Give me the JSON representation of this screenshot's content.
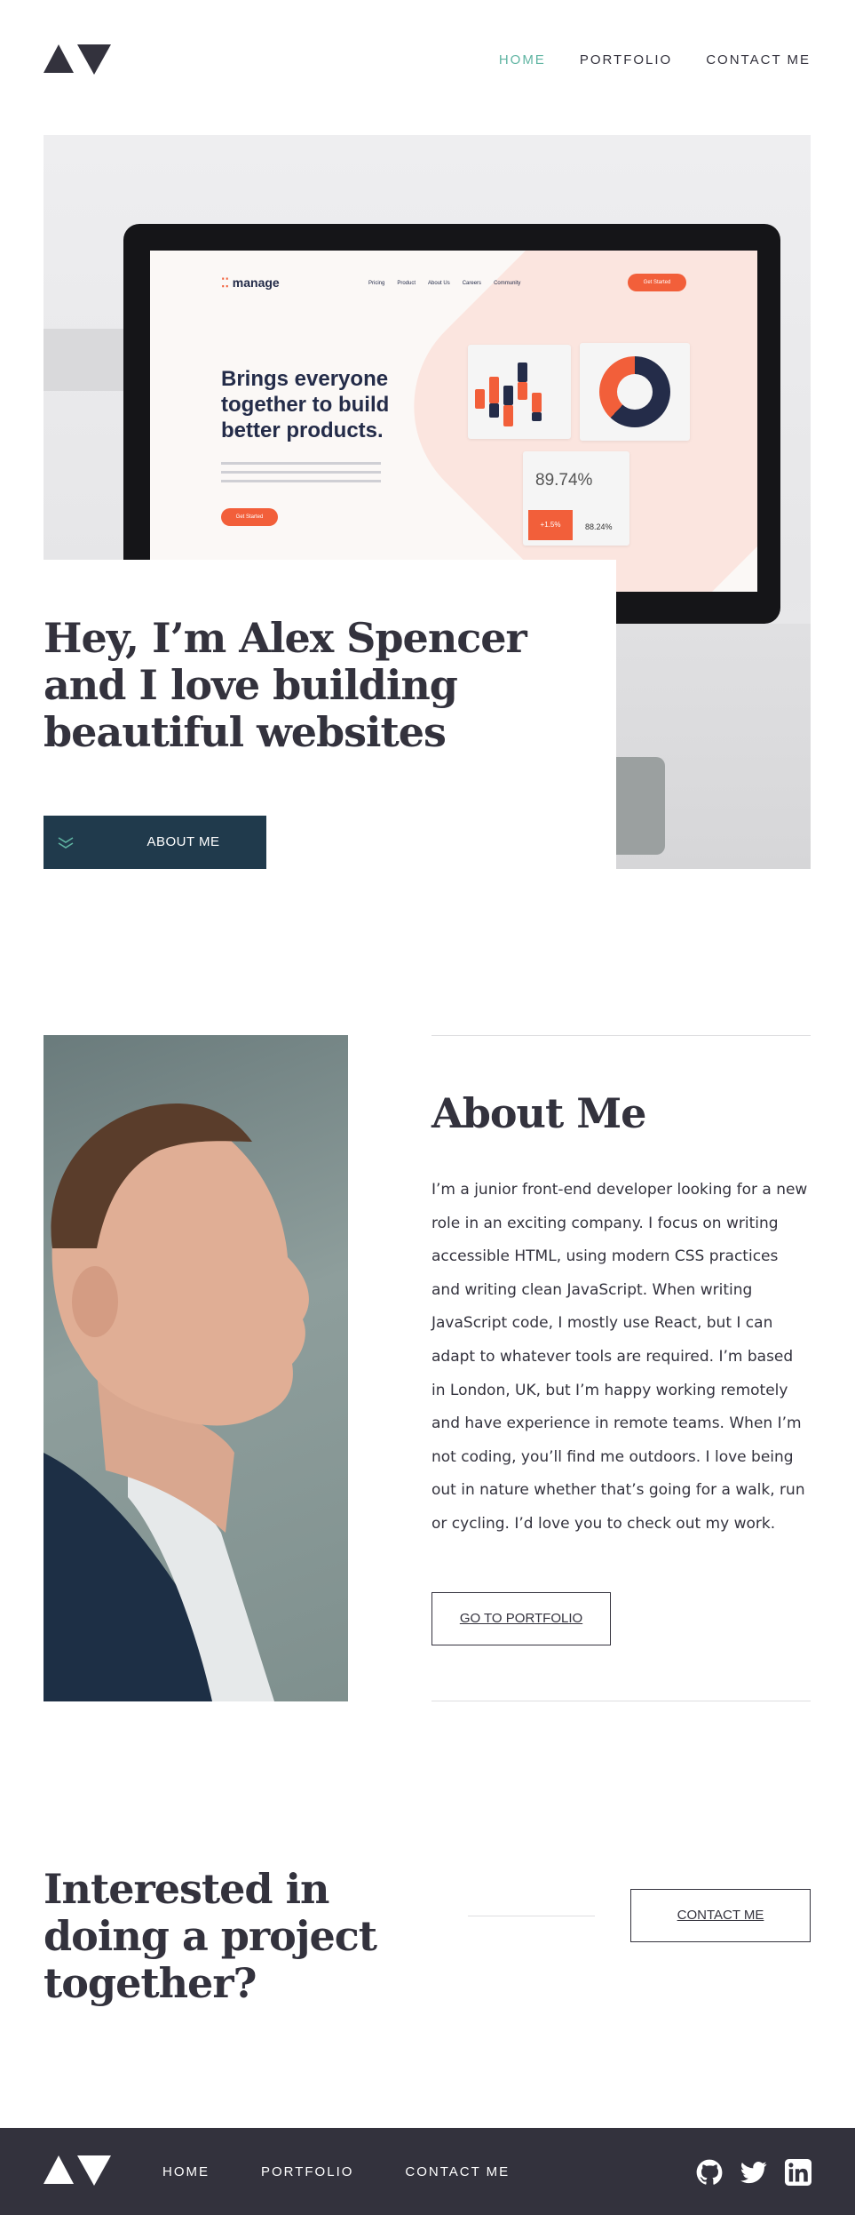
{
  "nav": {
    "items": [
      {
        "label": "HOME",
        "active": true
      },
      {
        "label": "PORTFOLIO",
        "active": false
      },
      {
        "label": "CONTACT ME",
        "active": false
      }
    ],
    "logo_icon": "triangle-logo-icon"
  },
  "hero": {
    "title": "Hey, I’m Alex Spencer and I love building beautiful websites",
    "button_label": "ABOUT ME",
    "button_icon": "double-chevron-down-icon",
    "screen": {
      "logo": "manage",
      "nav": [
        "Pricing",
        "Product",
        "About Us",
        "Careers",
        "Community"
      ],
      "cta": "Get Started",
      "headline": "Brings everyone together to build better products.",
      "button": "Get Started",
      "stat_main": "89.74%",
      "stat_badge": "+1.5%",
      "stat_secondary": "88.24%"
    }
  },
  "about": {
    "title": "About Me",
    "body": "I’m a junior front-end developer looking for a new role in an exciting company. I focus on writing accessible HTML, using modern CSS practices and writing clean JavaScript. When writing JavaScript code, I mostly use React, but I can adapt to whatever tools are required. I’m based in London, UK, but I’m happy working remotely and have experience in remote teams. When I’m not coding, you’ll find me outdoors. I love being out in nature whether that’s going for a walk, run or cycling. I’d love you to check out my work.",
    "button_label": "GO TO PORTFOLIO"
  },
  "cta": {
    "title": "Interested in doing a project together?",
    "button_label": "CONTACT ME"
  },
  "footer": {
    "nav": [
      "HOME",
      "PORTFOLIO",
      "CONTACT ME"
    ],
    "social": [
      "github-icon",
      "twitter-icon",
      "linkedin-icon"
    ]
  },
  "colors": {
    "dark": "#33323d",
    "accent": "#5fb4a2",
    "button_dark": "#203a4c",
    "rule": "#dedee0"
  }
}
